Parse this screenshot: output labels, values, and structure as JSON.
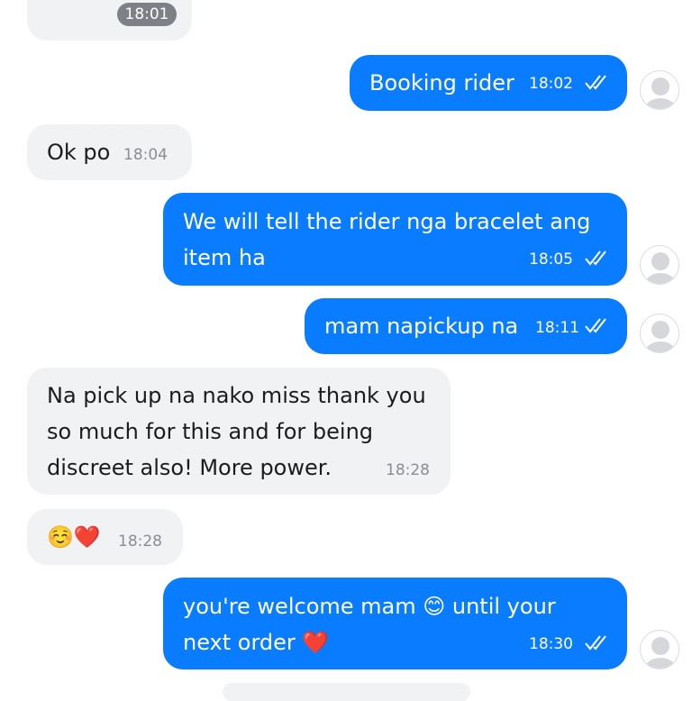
{
  "messages": [
    {
      "side": "in",
      "lines": [],
      "time": "18:01"
    },
    {
      "side": "out",
      "lines": [
        "Booking rider"
      ],
      "time": "18:02"
    },
    {
      "side": "in",
      "lines": [
        "Ok po"
      ],
      "time": "18:04"
    },
    {
      "side": "out",
      "lines": [
        "We will tell the rider nga bracelet ang",
        "item ha"
      ],
      "time": "18:05"
    },
    {
      "side": "out",
      "lines": [
        "mam napickup na"
      ],
      "time": "18:11"
    },
    {
      "side": "in",
      "lines": [
        "Na pick up na nako miss thank you",
        "so much for this and for being",
        "discreet also! More power."
      ],
      "time": "18:28"
    },
    {
      "side": "in",
      "lines": [
        "☺️❤️"
      ],
      "time": "18:28"
    },
    {
      "side": "out",
      "lines": [
        "you're welcome mam 😊 until your",
        "next order ❤️"
      ],
      "time": "18:30"
    }
  ],
  "icons": {
    "read_receipt": "double-check-icon",
    "avatar": "default-user-avatar-icon"
  },
  "colors": {
    "outgoing_bubble": "#0a7cff",
    "incoming_bubble": "#f1f2f4",
    "incoming_text": "#1c1c1e",
    "timestamp_gray": "#8a8d93",
    "avatar_gray": "#d5d7db"
  }
}
